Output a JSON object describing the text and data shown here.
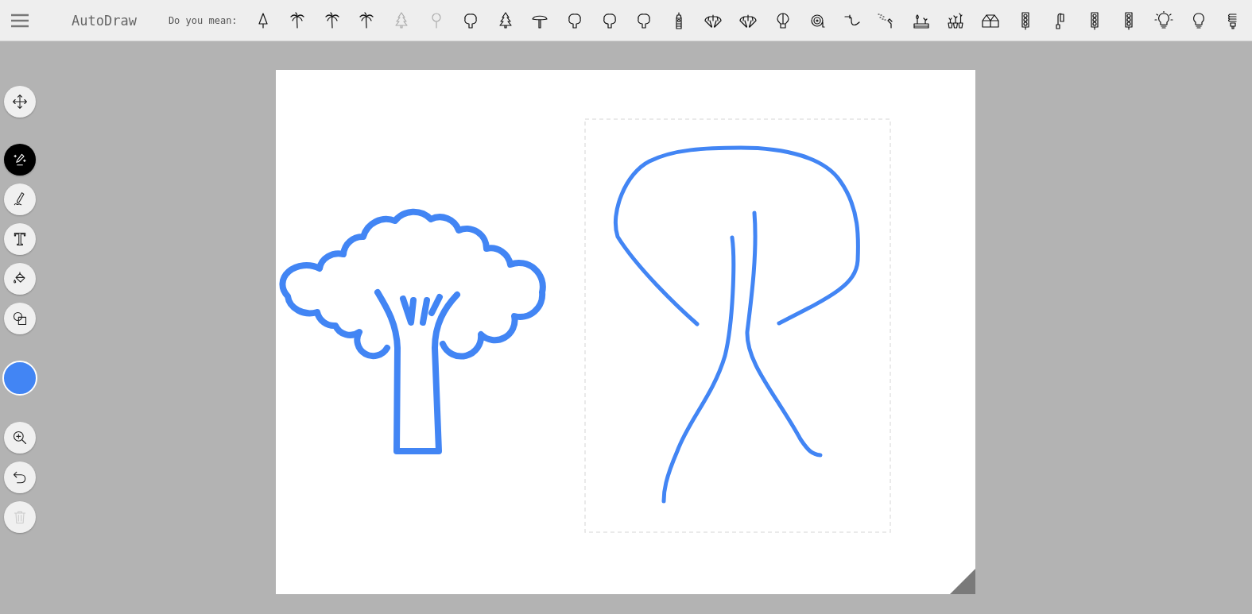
{
  "app": {
    "title": "AutoDraw"
  },
  "suggestions": {
    "label": "Do you mean:",
    "items": [
      {
        "kind": "cone-tree",
        "faded": false
      },
      {
        "kind": "palm",
        "faded": false
      },
      {
        "kind": "palm",
        "faded": false
      },
      {
        "kind": "palm",
        "faded": false
      },
      {
        "kind": "pine",
        "faded": true
      },
      {
        "kind": "lollipop",
        "faded": true
      },
      {
        "kind": "round-tree",
        "faded": false
      },
      {
        "kind": "pine",
        "faded": false
      },
      {
        "kind": "mushroom-tree",
        "faded": false
      },
      {
        "kind": "round-tree",
        "faded": false
      },
      {
        "kind": "round-tree",
        "faded": false
      },
      {
        "kind": "round-tree",
        "faded": false
      },
      {
        "kind": "tower",
        "faded": false
      },
      {
        "kind": "parachute",
        "faded": false
      },
      {
        "kind": "parachute",
        "faded": false
      },
      {
        "kind": "balloon",
        "faded": false
      },
      {
        "kind": "hose-reel",
        "faded": false
      },
      {
        "kind": "hose",
        "faded": false
      },
      {
        "kind": "sprinkler",
        "faded": false
      },
      {
        "kind": "garden",
        "faded": false
      },
      {
        "kind": "plants",
        "faded": false
      },
      {
        "kind": "greenhouse",
        "faded": false
      },
      {
        "kind": "traffic-light",
        "faded": false
      },
      {
        "kind": "street-lamp",
        "faded": false
      },
      {
        "kind": "traffic-light",
        "faded": false
      },
      {
        "kind": "traffic-light",
        "faded": false
      },
      {
        "kind": "bulb-rays",
        "faded": false
      },
      {
        "kind": "bulb",
        "faded": false
      },
      {
        "kind": "cfl",
        "faded": false
      }
    ]
  },
  "tools": [
    {
      "kind": "move",
      "selected": false
    },
    {
      "kind": "autodraw",
      "selected": true
    },
    {
      "kind": "draw",
      "selected": false
    },
    {
      "kind": "type",
      "selected": false
    },
    {
      "kind": "fill",
      "selected": false
    },
    {
      "kind": "shape",
      "selected": false
    }
  ],
  "color": {
    "color": "#4285f4"
  },
  "actions": [
    {
      "kind": "zoom",
      "disabled": false
    },
    {
      "kind": "undo",
      "disabled": false
    },
    {
      "kind": "delete",
      "disabled": true
    }
  ]
}
